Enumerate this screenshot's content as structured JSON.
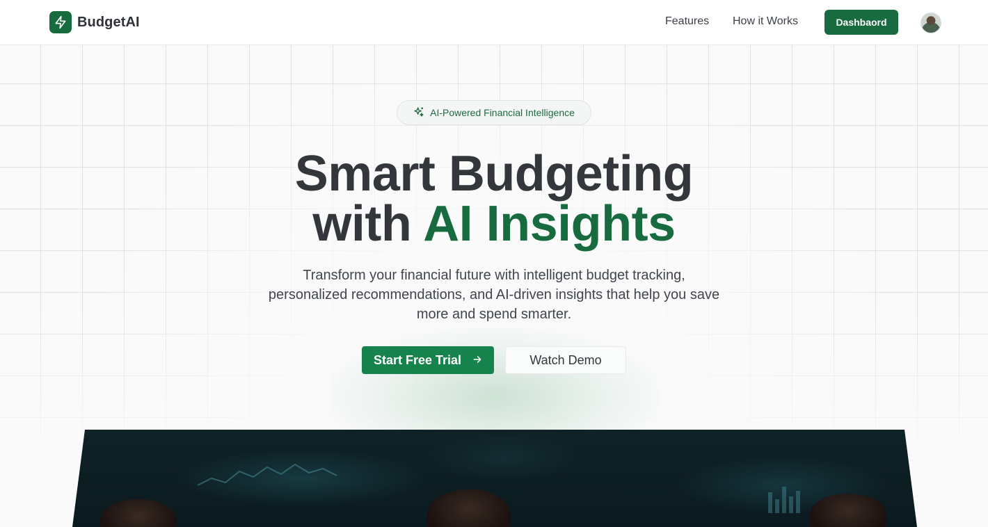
{
  "header": {
    "brand": "BudgetAI",
    "nav": [
      {
        "label": "Features"
      },
      {
        "label": "How it Works"
      }
    ],
    "dashboard_label": "Dashbaord"
  },
  "hero": {
    "badge": "AI-Powered Financial Intelligence",
    "title_line1": "Smart Budgeting",
    "title_line2_prefix": "with ",
    "title_line2_accent": "AI Insights",
    "subtitle": "Transform your financial future with intelligent budget tracking, personalized recommendations, and AI-driven insights that help you save more and spend smarter.",
    "primary_cta": "Start Free Trial",
    "secondary_cta": "Watch Demo"
  },
  "icons": {
    "logo": "lightning-bolt-icon",
    "badge": "sparkles-icon",
    "cta": "arrow-right-icon"
  },
  "colors": {
    "brand_green": "#176b3e",
    "cta_green": "#15834b",
    "text_dark": "#33363b",
    "background": "#fafafb"
  }
}
